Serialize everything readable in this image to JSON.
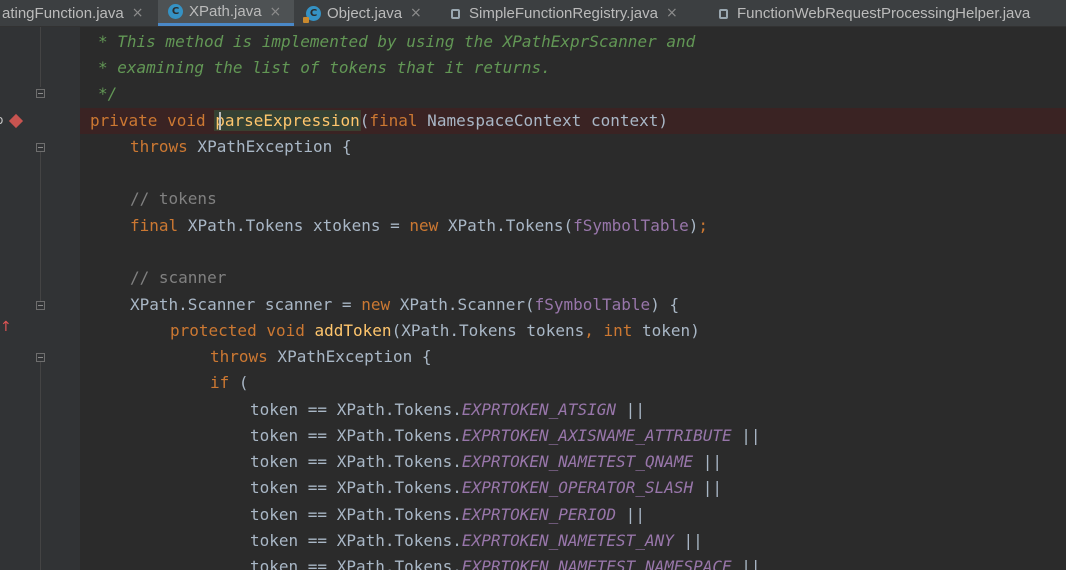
{
  "tabs": [
    {
      "label": "atingFunction.java",
      "icon": "java-class-icon",
      "active": false
    },
    {
      "label": "XPath.java",
      "icon": "java-class-icon",
      "active": true
    },
    {
      "label": "Object.java",
      "icon": "java-class-locked-icon",
      "active": false
    },
    {
      "label": "SimpleFunctionRegistry.java",
      "icon": "locked-file-icon",
      "active": false
    },
    {
      "label": "FunctionWebRequestProcessingHelper.java",
      "icon": "locked-file-icon",
      "active": false
    }
  ],
  "close_glyph": "×",
  "code": {
    "l1": "* This method is implemented by using the XPathExprScanner and",
    "l2": "* examining the list of tokens that it returns.",
    "l3": "*/",
    "l4_kw": "private void ",
    "l4_name": "parseExpression",
    "l4_rest_a": "(",
    "l4_final": "final",
    "l4_rest_b": " NamespaceContext context)",
    "l5_kw": "throws",
    "l5_rest": " XPathException {",
    "l6": "",
    "l7": "// tokens",
    "l8_kw": "final",
    "l8_mid": " XPath.Tokens xtokens = ",
    "l8_new": "new",
    "l8_mid2": " XPath.Tokens(",
    "l8_fld": "fSymbolTable",
    "l8_end": ")",
    "l8_semi": ";",
    "l9": "",
    "l10": "// scanner",
    "l11_a": "XPath.Scanner scanner = ",
    "l11_new": "new",
    "l11_b": " XPath.Scanner(",
    "l11_fld": "fSymbolTable",
    "l11_c": ") {",
    "l12_kw": "protected void ",
    "l12_fn": "addToken",
    "l12_a": "(XPath.Tokens tokens",
    "l12_comma": ", ",
    "l12_int": "int",
    "l12_b": " token)",
    "l13_kw": "throws",
    "l13_rest": " XPathException {",
    "l14_kw": "if",
    "l14_rest": " (",
    "tok_prefix": "token == XPath.Tokens.",
    "tokens": [
      "EXPRTOKEN_ATSIGN",
      "EXPRTOKEN_AXISNAME_ATTRIBUTE",
      "EXPRTOKEN_NAMETEST_QNAME",
      "EXPRTOKEN_OPERATOR_SLASH",
      "EXPRTOKEN_PERIOD",
      "EXPRTOKEN_NAMETEST_ANY",
      "EXPRTOKEN_NAMETEST_NAMESPACE"
    ],
    "or_op": " ||"
  },
  "colors": {
    "background": "#2b2b2b",
    "keyword": "#cc7832",
    "javadoc": "#629755",
    "line_comment": "#808080",
    "field": "#9876aa",
    "method": "#ffc66d",
    "default_text": "#a9b7c6",
    "breakpoint": "#c75450"
  }
}
